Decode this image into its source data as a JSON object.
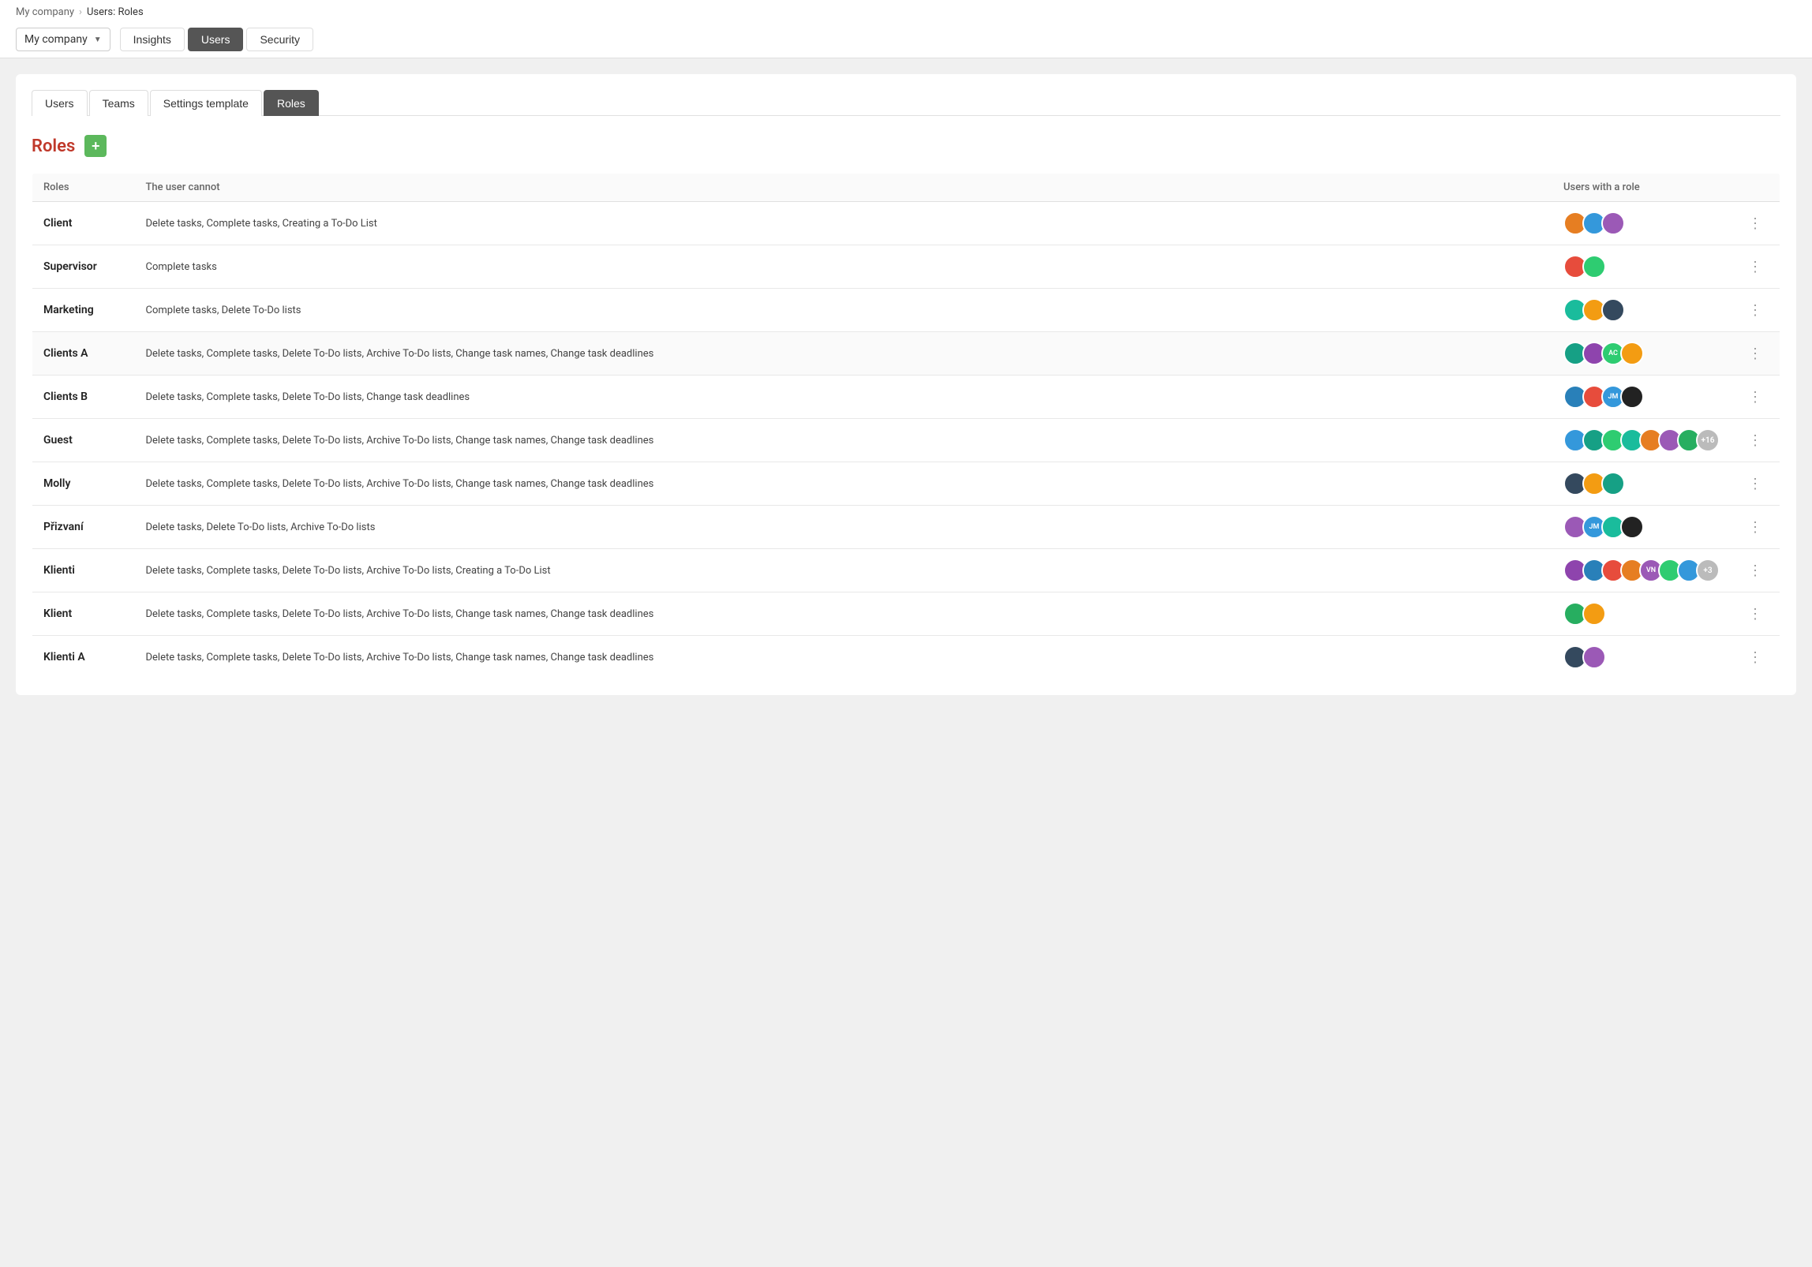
{
  "breadcrumb": {
    "parent": "My company",
    "separator": "›",
    "current": "Users: Roles"
  },
  "nav": {
    "company_selector": "My company",
    "tabs": [
      {
        "label": "Insights",
        "active": false
      },
      {
        "label": "Users",
        "active": true
      },
      {
        "label": "Security",
        "active": false
      }
    ]
  },
  "sub_tabs": [
    {
      "label": "Users",
      "active": false
    },
    {
      "label": "Teams",
      "active": false
    },
    {
      "label": "Settings template",
      "active": false
    },
    {
      "label": "Roles",
      "active": true
    }
  ],
  "roles_section": {
    "title": "Roles",
    "add_button_label": "+",
    "table": {
      "headers": [
        "Roles",
        "The user cannot",
        "Users with a role",
        ""
      ],
      "rows": [
        {
          "name": "Client",
          "restrictions": "Delete tasks, Complete tasks, Creating a To-Do List",
          "user_count": 3,
          "extra": ""
        },
        {
          "name": "Supervisor",
          "restrictions": "Complete tasks",
          "user_count": 2,
          "extra": ""
        },
        {
          "name": "Marketing",
          "restrictions": "Complete tasks, Delete To-Do lists",
          "user_count": 3,
          "extra": ""
        },
        {
          "name": "Clients A",
          "restrictions": "Delete tasks, Complete tasks, Delete To-Do lists, Archive To-Do lists, Change task names, Change task deadlines",
          "user_count": 4,
          "extra": ""
        },
        {
          "name": "Clients B",
          "restrictions": "Delete tasks, Complete tasks, Delete To-Do lists, Change task deadlines",
          "user_count": 4,
          "extra": ""
        },
        {
          "name": "Guest",
          "restrictions": "Delete tasks, Complete tasks, Delete To-Do lists, Archive To-Do lists, Change task names, Change task deadlines",
          "user_count": 7,
          "extra": "+16"
        },
        {
          "name": "Molly",
          "restrictions": "Delete tasks, Complete tasks, Delete To-Do lists, Archive To-Do lists, Change task names, Change task deadlines",
          "user_count": 3,
          "extra": ""
        },
        {
          "name": "Přizvaní",
          "restrictions": "Delete tasks, Delete To-Do lists, Archive To-Do lists",
          "user_count": 4,
          "extra": ""
        },
        {
          "name": "Klienti",
          "restrictions": "Delete tasks, Complete tasks, Delete To-Do lists, Archive To-Do lists, Creating a To-Do List",
          "user_count": 7,
          "extra": "+3"
        },
        {
          "name": "Klient",
          "restrictions": "Delete tasks, Complete tasks, Delete To-Do lists, Archive To-Do lists, Change task names, Change task deadlines",
          "user_count": 2,
          "extra": ""
        },
        {
          "name": "Klienti A",
          "restrictions": "Delete tasks, Complete tasks, Delete To-Do lists, Archive To-Do lists, Change task names, Change task deadlines",
          "user_count": 2,
          "extra": ""
        }
      ]
    }
  }
}
